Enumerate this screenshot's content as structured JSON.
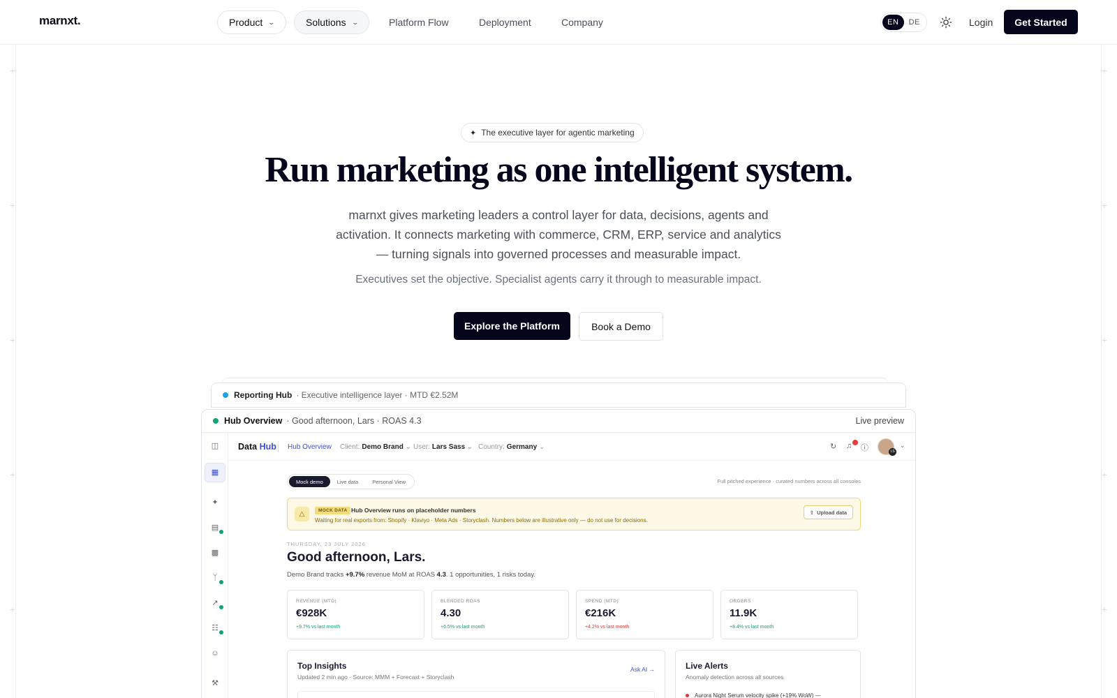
{
  "nav": {
    "logo": "marnxt.",
    "product": "Product",
    "solutions": "Solutions",
    "platform_flow": "Platform Flow",
    "deployment": "Deployment",
    "company": "Company",
    "lang_en": "EN",
    "lang_de": "DE",
    "login": "Login",
    "get_started": "Get Started"
  },
  "hero": {
    "eyebrow": "The executive layer for agentic marketing",
    "title": "Run marketing as one intelligent system.",
    "subtitle": "marnxt gives marketing leaders a control layer for data, decisions, agents and activation. It connects marketing with commerce, CRM, ERP, service and analytics — turning signals into governed processes and measurable impact.",
    "subtitle2": "Executives set the objective. Specialist agents carry it through to measurable impact.",
    "primary_cta": "Explore the Platform",
    "secondary_cta": "Book a Demo"
  },
  "preview": {
    "back_card": {
      "title": "Reporting Hub",
      "meta": "· Executive intelligence layer · MTD €2.52M",
      "dot_color": "#1aa3e8"
    },
    "window": {
      "title": "Hub Overview",
      "meta": "· Good afternoon, Lars · ROAS 4.3",
      "live": "Live preview",
      "dot_color": "#12a36f"
    }
  },
  "app": {
    "brand_a": "Data",
    "brand_b": "Hub",
    "crumb": "Hub Overview",
    "client_label": "Client:",
    "client_value": "Demo Brand",
    "user_label": "User:",
    "user_value": "Lars Sass",
    "country_label": "Country:",
    "country_value": "Germany",
    "avatar_initials": "LS",
    "notification_count": "3",
    "toggle": [
      "Mock demo",
      "Live data",
      "Personal View"
    ],
    "pitch_note": "Full pitched experience · curated numbers across all consoles",
    "banner": {
      "tag": "MOCK DATA",
      "title": "Hub Overview runs on placeholder numbers",
      "subtitle": "Waiting for real exports from: Shopify · Klaviyo · Meta Ads · Storyclash. Numbers below are illustrative only — do not use for decisions.",
      "upload": "Upload data"
    },
    "date": "THURSDAY, 23 JULY 2026",
    "greeting": "Good afternoon, Lars.",
    "tracks": {
      "prefix": "Demo Brand tracks",
      "growth": "+9.7%",
      "middle": "revenue MoM at ROAS",
      "roas": "4.3",
      "suffix": ". 1 opportunities, 1 risks today."
    },
    "kpis": [
      {
        "label": "REVENUE (MTD)",
        "value": "€928K",
        "delta": "+9.7% vs last month",
        "trend": "positive"
      },
      {
        "label": "BLENDED ROAS",
        "value": "4.30",
        "delta": "+6.5% vs last month",
        "trend": "positive"
      },
      {
        "label": "SPEND (MTD)",
        "value": "€216K",
        "delta": "+4.2% vs last month",
        "trend": "negative"
      },
      {
        "label": "ORDERS",
        "value": "11.9K",
        "delta": "+8.4% vs last month",
        "trend": "positive"
      }
    ],
    "insights": {
      "title": "Top Insights",
      "subtitle": "Updated 2 min ago · Source: MMM + Forecast + Storyclash",
      "action": "Ask AI →"
    },
    "alerts": {
      "title": "Live Alerts",
      "subtitle": "Anomaly detection across all sources",
      "first": "Aurora Night Serum velocity spike (+19% WoW) —"
    }
  },
  "colors": {
    "ink": "#05051c",
    "accent": "#3b4fd6",
    "positive": "#12a36f",
    "negative": "#d33a3a",
    "warning_bg": "#fdf9e6"
  }
}
